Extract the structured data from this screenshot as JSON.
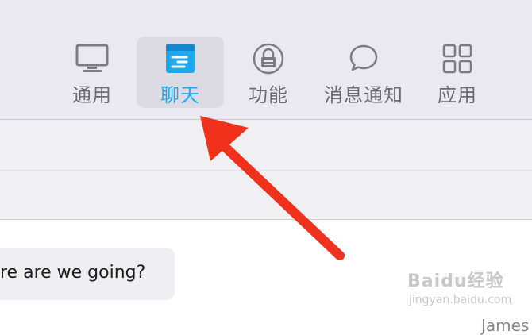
{
  "toolbar": {
    "tabs": [
      {
        "label": "通用",
        "icon": "monitor-icon"
      },
      {
        "label": "聊天",
        "icon": "chat-tab-icon",
        "selected": true
      },
      {
        "label": "功能",
        "icon": "lock-icon"
      },
      {
        "label": "消息通知",
        "icon": "speech-bubble-icon"
      },
      {
        "label": "应用",
        "icon": "apps-grid-icon"
      }
    ]
  },
  "chat": {
    "bubble_text": "re are we going?",
    "bottom_fragment": "James"
  },
  "watermark": {
    "brand": "Baidu经验",
    "url": "jingyan.baidu.com"
  },
  "colors": {
    "toolbar_bg": "#eae9f2",
    "selected_tab_bg": "#dcdbe3",
    "accent_blue": "#1fa8ec",
    "arrow_red": "#f0311c"
  }
}
